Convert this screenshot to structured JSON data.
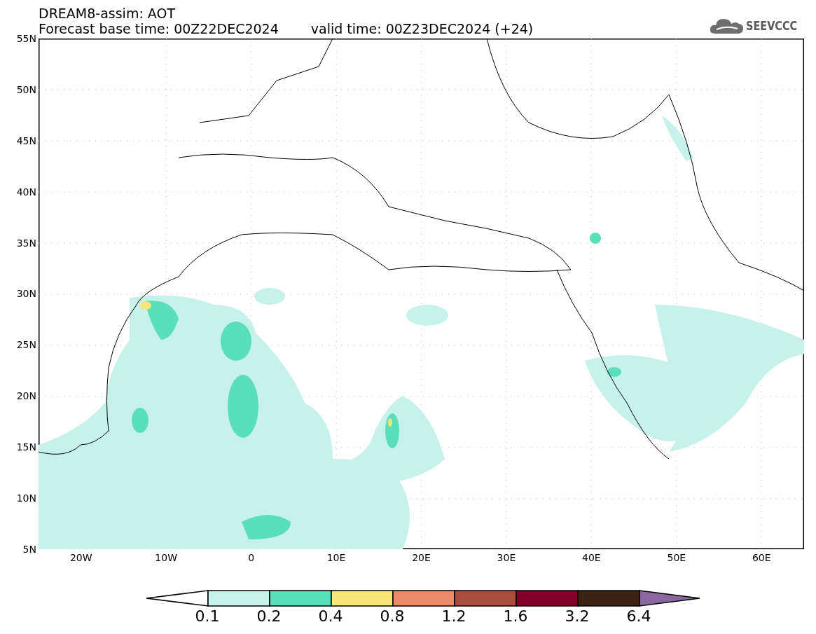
{
  "title": "DREAM8-assim: AOT",
  "subtitle": {
    "base_time": "Forecast base time: 00Z22DEC2024",
    "valid_time": "valid time: 00Z23DEC2024 (+24)"
  },
  "logo": {
    "text": "SEEVCCC"
  },
  "lat_labels": [
    "55N",
    "50N",
    "45N",
    "40N",
    "35N",
    "30N",
    "25N",
    "20N",
    "15N",
    "10N",
    "5N"
  ],
  "lon_labels": [
    "20W",
    "10W",
    "0",
    "10E",
    "20E",
    "30E",
    "40E",
    "50E",
    "60E"
  ],
  "colorbar": {
    "under": {
      "color": "#ffffff"
    },
    "over": {
      "color": "#8b67a0"
    },
    "segments": [
      {
        "color": "#c6f2ea"
      },
      {
        "color": "#5ae0b8"
      },
      {
        "color": "#f8e67a"
      },
      {
        "color": "#ea8a68"
      },
      {
        "color": "#a94c40"
      },
      {
        "color": "#80002a"
      },
      {
        "color": "#3b2312"
      }
    ],
    "labels": [
      "0.1",
      "0.2",
      "0.4",
      "0.8",
      "1.2",
      "1.6",
      "3.2",
      "6.4"
    ]
  }
}
